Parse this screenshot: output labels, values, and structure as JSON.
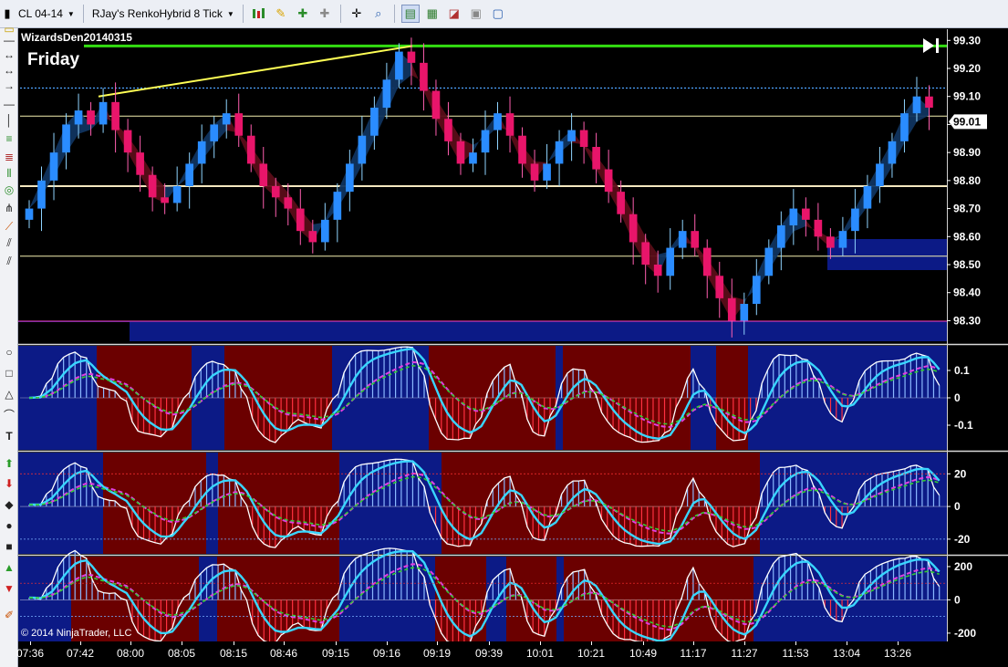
{
  "toolbar": {
    "instrument": "CL 04-14",
    "bar_type": "RJay's RenkoHybrid  8 Tick",
    "icons": [
      "bar-type-icon",
      "pencil-icon",
      "zoom-plus-icon",
      "zoom-minus-icon",
      "crosshair-icon",
      "magnify-icon",
      "data-box-icon",
      "chart-properties-icon",
      "indicators-icon",
      "strategies-icon",
      "window-icon"
    ]
  },
  "chart": {
    "label": "WizardsDen20140315",
    "day": "Friday",
    "last_price": "99.01",
    "copyright": "© 2014 NinjaTrader, LLC",
    "colors": {
      "background": "#000000",
      "up_bar": "#2a8cff",
      "down_bar": "#e8156a",
      "green_line": "#33dd11",
      "yellow_line": "#ffff55",
      "blue_zone": "#0c1a86",
      "red_zone": "#6b0000",
      "cyan_line": "#39d6ff",
      "magenta_dash": "#e040e0",
      "green_dash": "#33cc33"
    }
  },
  "chart_data": [
    {
      "type": "candlestick",
      "title": "WizardsDen20140315",
      "yaxis_ticks": [
        "99.30",
        "99.20",
        "99.10",
        "99.00",
        "98.90",
        "98.80",
        "98.70",
        "98.60",
        "98.50",
        "98.40",
        "98.30"
      ],
      "ylim": [
        98.22,
        99.34
      ],
      "last_price": 99.01,
      "horizontal_lines": [
        99.28,
        99.13,
        99.03,
        98.78,
        98.53
      ],
      "closes": [
        98.7,
        98.8,
        98.9,
        99.0,
        99.05,
        99.0,
        99.08,
        98.98,
        98.9,
        98.82,
        98.74,
        98.72,
        98.78,
        98.86,
        98.94,
        99.0,
        99.04,
        98.96,
        98.86,
        98.78,
        98.74,
        98.7,
        98.62,
        98.58,
        98.66,
        98.76,
        98.86,
        98.96,
        99.06,
        99.16,
        99.26,
        99.22,
        99.12,
        99.02,
        98.94,
        98.86,
        98.9,
        98.98,
        99.04,
        98.96,
        98.86,
        98.8,
        98.86,
        98.94,
        98.98,
        98.92,
        98.84,
        98.76,
        98.68,
        98.58,
        98.5,
        98.46,
        98.56,
        98.62,
        98.56,
        98.46,
        98.38,
        98.3,
        98.36,
        98.46,
        98.56,
        98.64,
        98.7,
        98.66,
        98.6,
        98.56,
        98.62,
        98.7,
        98.78,
        98.86,
        98.94,
        99.04,
        99.1,
        99.06
      ]
    },
    {
      "type": "line",
      "yaxis_ticks": [
        "0.1",
        "0",
        "-0.1"
      ],
      "ylim": [
        -0.19,
        0.19
      ]
    },
    {
      "type": "line",
      "yaxis_ticks": [
        "20",
        "0",
        "-20"
      ],
      "ylim": [
        -29,
        33
      ]
    },
    {
      "type": "line",
      "yaxis_ticks": [
        "200",
        "0",
        "-200"
      ],
      "ylim": [
        -250,
        260
      ]
    }
  ],
  "time_axis": [
    "07:36",
    "07:42",
    "08:00",
    "08:05",
    "08:15",
    "08:46",
    "09:15",
    "09:16",
    "09:19",
    "09:39",
    "10:01",
    "10:21",
    "10:49",
    "11:17",
    "11:27",
    "11:53",
    "13:04",
    "13:26"
  ]
}
